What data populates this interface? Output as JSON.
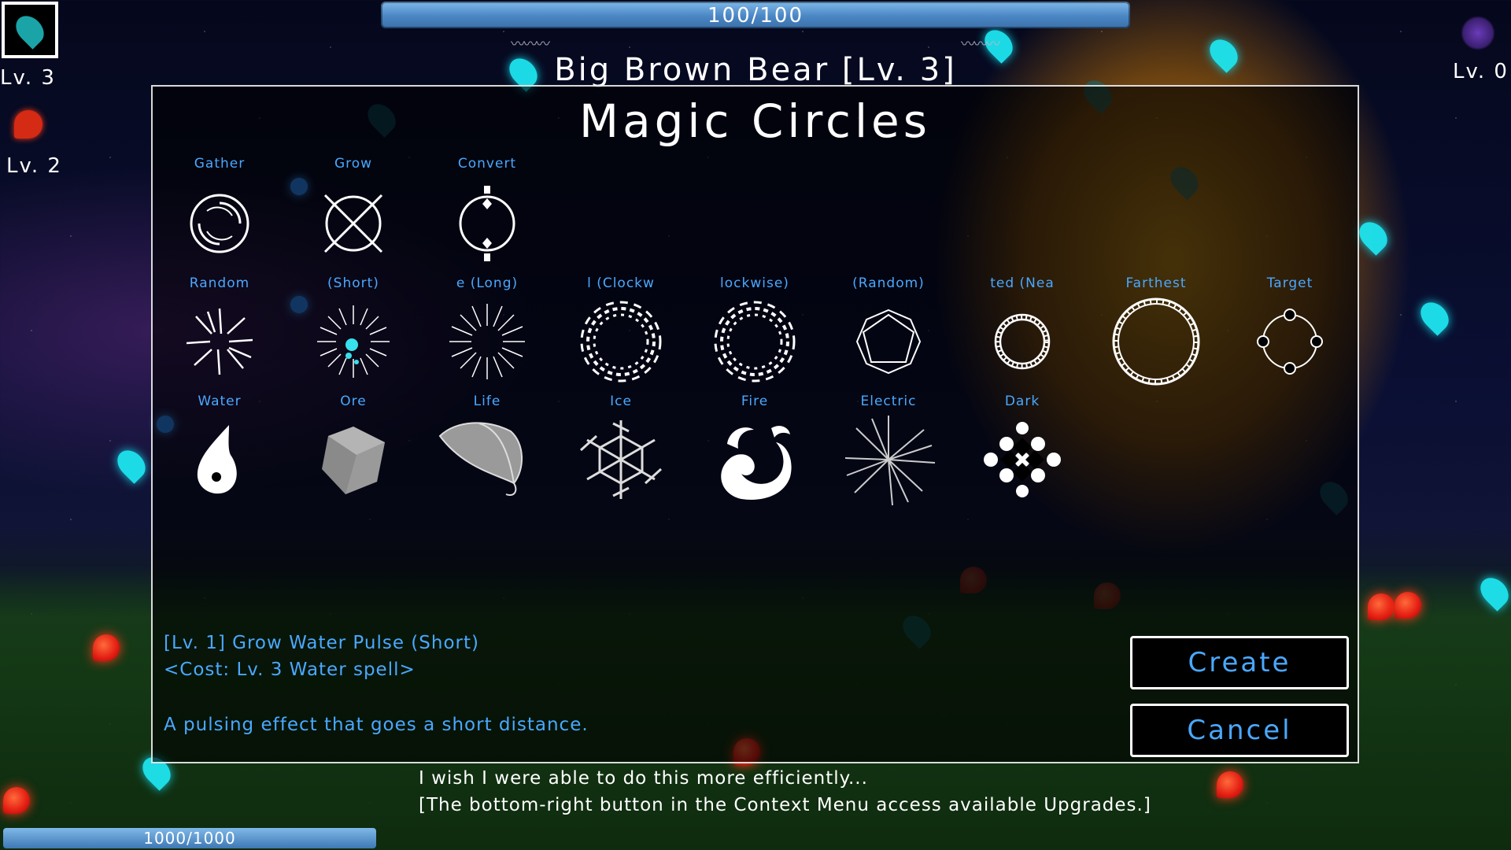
{
  "hud": {
    "enemy_hp": "100/100",
    "enemy_name": "Big Brown Bear [Lv. 3]",
    "player_slot_level": "Lv. 3",
    "fire_level": "Lv. 2",
    "right_level": "Lv. 0",
    "mana": "1000/1000"
  },
  "panel": {
    "title": "Magic Circles",
    "row1": [
      {
        "label": "Gather",
        "icon": "gather-circle-icon"
      },
      {
        "label": "Grow",
        "icon": "grow-circle-icon"
      },
      {
        "label": "Convert",
        "icon": "convert-circle-icon"
      }
    ],
    "row2": [
      {
        "label": "Random",
        "icon": "random-burst-icon"
      },
      {
        "label": "(Short)",
        "icon": "pulse-short-icon"
      },
      {
        "label": "e (Long)",
        "icon": "pulse-long-icon"
      },
      {
        "label": "l (Clockw",
        "icon": "spiral-clockwise-icon"
      },
      {
        "label": "lockwise)",
        "icon": "spiral-counterclockwise-icon"
      },
      {
        "label": "(Random)",
        "icon": "octagram-random-icon"
      },
      {
        "label": "ted (Nea",
        "icon": "ring-nearest-icon"
      },
      {
        "label": "Farthest",
        "icon": "ring-farthest-icon"
      },
      {
        "label": "Target",
        "icon": "target-circle-icon"
      }
    ],
    "row3": [
      {
        "label": "Water",
        "icon": "water-drop-icon"
      },
      {
        "label": "Ore",
        "icon": "ore-cube-icon"
      },
      {
        "label": "Life",
        "icon": "life-leaf-icon"
      },
      {
        "label": "Ice",
        "icon": "ice-snowflake-icon"
      },
      {
        "label": "Fire",
        "icon": "fire-swirl-icon"
      },
      {
        "label": "Electric",
        "icon": "electric-burst-icon"
      },
      {
        "label": "Dark",
        "icon": "dark-diamond-icon"
      }
    ],
    "description": {
      "name": "[Lv. 1] Grow Water Pulse (Short)",
      "cost": "<Cost: Lv. 3 Water spell>",
      "text": "A pulsing effect that goes a short distance."
    },
    "create_label": "Create",
    "cancel_label": "Cancel"
  },
  "tips": {
    "line1": "I wish I were able to do this more efficiently...",
    "line2": "[The bottom-right button in the Context Menu access available Upgrades.]"
  },
  "colors": {
    "accent_blue": "#4aa8ff",
    "water_cyan": "#1ee6f0",
    "fire_red": "#e31c12",
    "moon_gold": "#c88c14"
  }
}
